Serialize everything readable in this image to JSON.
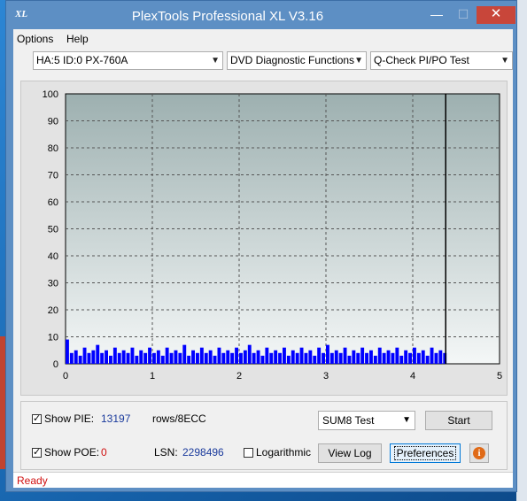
{
  "window": {
    "title": "PlexTools Professional XL V3.16",
    "icon_label": "XL",
    "min_glyph": "—",
    "max_glyph": "☐",
    "close_glyph": "✕"
  },
  "menu": {
    "items": [
      {
        "label": "Options"
      },
      {
        "label": "Help"
      }
    ]
  },
  "toolbar": {
    "drive": "HA:5 ID:0  PX-760A",
    "function": "DVD Diagnostic Functions",
    "test": "Q-Check PI/PO Test"
  },
  "chart_data": {
    "type": "bar",
    "x_ticks": [
      "0",
      "1",
      "2",
      "3",
      "4",
      "5"
    ],
    "y_ticks": [
      "0",
      "10",
      "20",
      "30",
      "40",
      "50",
      "60",
      "70",
      "80",
      "90",
      "100"
    ],
    "xlim": [
      0,
      5
    ],
    "ylim": [
      0,
      100
    ],
    "grid": true,
    "scan_end_x": 4.38,
    "series": [
      {
        "values": [
          [
            0.0,
            9
          ],
          [
            0.05,
            4
          ],
          [
            0.1,
            5
          ],
          [
            0.15,
            3
          ],
          [
            0.2,
            6
          ],
          [
            0.25,
            4
          ],
          [
            0.3,
            5
          ],
          [
            0.35,
            7
          ],
          [
            0.4,
            4
          ],
          [
            0.45,
            5
          ],
          [
            0.5,
            3
          ],
          [
            0.55,
            6
          ],
          [
            0.6,
            4
          ],
          [
            0.65,
            5
          ],
          [
            0.7,
            4
          ],
          [
            0.75,
            6
          ],
          [
            0.8,
            3
          ],
          [
            0.85,
            5
          ],
          [
            0.9,
            4
          ],
          [
            0.95,
            6
          ],
          [
            1.0,
            4
          ],
          [
            1.05,
            5
          ],
          [
            1.1,
            3
          ],
          [
            1.15,
            6
          ],
          [
            1.2,
            4
          ],
          [
            1.25,
            5
          ],
          [
            1.3,
            4
          ],
          [
            1.35,
            7
          ],
          [
            1.4,
            3
          ],
          [
            1.45,
            5
          ],
          [
            1.5,
            4
          ],
          [
            1.55,
            6
          ],
          [
            1.6,
            4
          ],
          [
            1.65,
            5
          ],
          [
            1.7,
            3
          ],
          [
            1.75,
            6
          ],
          [
            1.8,
            4
          ],
          [
            1.85,
            5
          ],
          [
            1.9,
            4
          ],
          [
            1.95,
            6
          ],
          [
            2.0,
            4
          ],
          [
            2.05,
            5
          ],
          [
            2.1,
            7
          ],
          [
            2.15,
            4
          ],
          [
            2.2,
            5
          ],
          [
            2.25,
            3
          ],
          [
            2.3,
            6
          ],
          [
            2.35,
            4
          ],
          [
            2.4,
            5
          ],
          [
            2.45,
            4
          ],
          [
            2.5,
            6
          ],
          [
            2.55,
            3
          ],
          [
            2.6,
            5
          ],
          [
            2.65,
            4
          ],
          [
            2.7,
            6
          ],
          [
            2.75,
            4
          ],
          [
            2.8,
            5
          ],
          [
            2.85,
            3
          ],
          [
            2.9,
            6
          ],
          [
            2.95,
            4
          ],
          [
            3.0,
            7
          ],
          [
            3.05,
            4
          ],
          [
            3.1,
            5
          ],
          [
            3.15,
            4
          ],
          [
            3.2,
            6
          ],
          [
            3.25,
            3
          ],
          [
            3.3,
            5
          ],
          [
            3.35,
            4
          ],
          [
            3.4,
            6
          ],
          [
            3.45,
            4
          ],
          [
            3.5,
            5
          ],
          [
            3.55,
            3
          ],
          [
            3.6,
            6
          ],
          [
            3.65,
            4
          ],
          [
            3.7,
            5
          ],
          [
            3.75,
            4
          ],
          [
            3.8,
            6
          ],
          [
            3.85,
            3
          ],
          [
            3.9,
            5
          ],
          [
            3.95,
            4
          ],
          [
            4.0,
            6
          ],
          [
            4.05,
            4
          ],
          [
            4.1,
            5
          ],
          [
            4.15,
            3
          ],
          [
            4.2,
            6
          ],
          [
            4.25,
            4
          ],
          [
            4.3,
            5
          ],
          [
            4.35,
            4
          ]
        ]
      }
    ]
  },
  "controls": {
    "show_pie_label": "Show PIE:",
    "pie_value": "13197",
    "pie_unit": "rows/8ECC",
    "show_poe_label": "Show POE:",
    "poe_value": "0",
    "lsn_label": "LSN:",
    "lsn_value": "2298496",
    "log_label": "Logarithmic",
    "sum_select": "SUM8 Test",
    "start_button": "Start",
    "view_log_button": "View Log",
    "preferences_button": "Preferences",
    "info_glyph": "i"
  },
  "status": {
    "text": "Ready"
  },
  "colors": {
    "bar": "#0000ff",
    "plot_bg_top": "#9db0b0",
    "plot_bg_bottom": "#f4f7f7",
    "status": "#d01010"
  }
}
